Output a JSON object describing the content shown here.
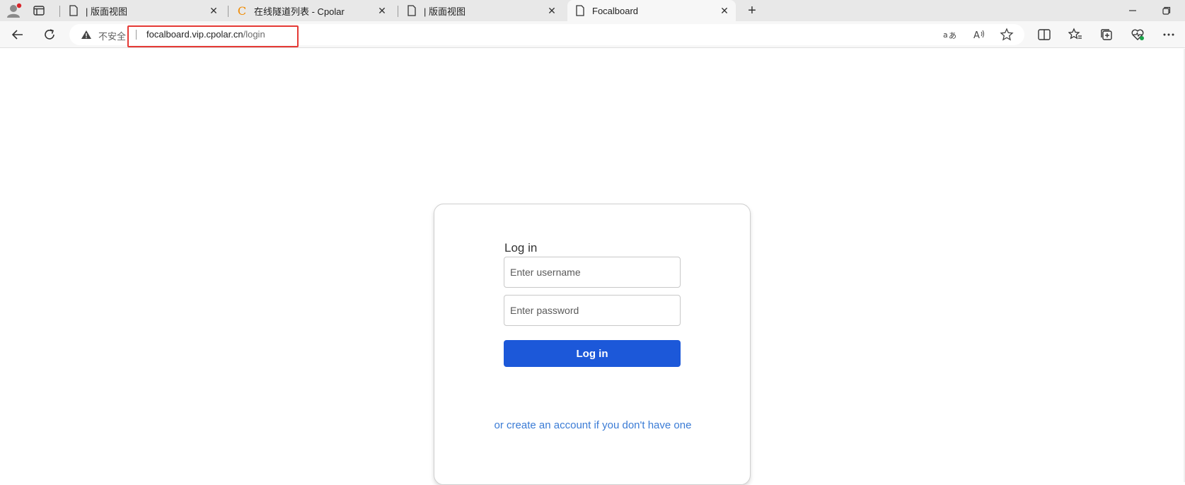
{
  "tabs": [
    {
      "title": "| 版面视图",
      "favicon": "page-icon",
      "active": false
    },
    {
      "title": "在线隧道列表 - Cpolar",
      "favicon": "cpolar-icon",
      "active": false
    },
    {
      "title": "| 版面视图",
      "favicon": "page-icon",
      "active": false
    },
    {
      "title": "Focalboard",
      "favicon": "page-icon",
      "active": true
    }
  ],
  "cpolar_glyph": "C",
  "address_bar": {
    "security_text": "不安全",
    "url_host": "focalboard.vip.cpolar.cn",
    "url_path": "/login"
  },
  "colors": {
    "accent": "#1c58d9",
    "link": "#3a7bd5",
    "highlight": "#e53935"
  },
  "login": {
    "title": "Log in",
    "username_placeholder": "Enter username",
    "password_placeholder": "Enter password",
    "button_label": "Log in",
    "signup_link": "or create an account if you don't have one"
  }
}
